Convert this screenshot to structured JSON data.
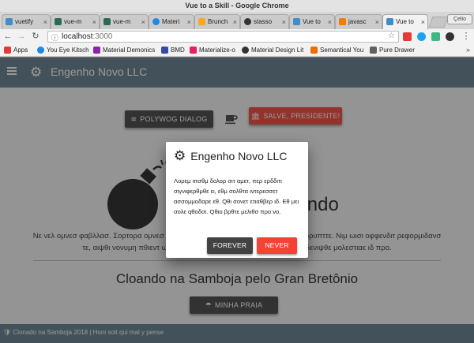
{
  "window": {
    "title": "Vue to a Skill - Google Chrome",
    "user_badge": "Çelio"
  },
  "tabs": [
    {
      "label": "vuetify",
      "color": "#3f8ec7"
    },
    {
      "label": "vue-m",
      "color": "#2c6b4f"
    },
    {
      "label": "vue-m",
      "color": "#2c6b4f"
    },
    {
      "label": "Materi",
      "color": "#1e88e5"
    },
    {
      "label": "Brunch",
      "color": "#f9a825"
    },
    {
      "label": "stasso",
      "color": "#333333"
    },
    {
      "label": "Vue to",
      "color": "#3f8ec7"
    },
    {
      "label": "javasc",
      "color": "#f57c00"
    },
    {
      "label": "Vue to",
      "color": "#3f8ec7"
    }
  ],
  "nav": {
    "url_host": "localhost",
    "url_port": ":3000"
  },
  "bookmarks": [
    {
      "label": "Apps",
      "color": "#e53935"
    },
    {
      "label": "You Eye Kitsch",
      "color": "#1e88e5"
    },
    {
      "label": "Material Demonics",
      "color": "#8e24aa"
    },
    {
      "label": "BMD",
      "color": "#3949ab"
    },
    {
      "label": "Materialize-o",
      "color": "#e91e63"
    },
    {
      "label": "Material Design Lit",
      "color": "#333333"
    },
    {
      "label": "Semantical You",
      "color": "#ef6c00"
    },
    {
      "label": "Pure Drawer",
      "color": "#616161"
    }
  ],
  "app": {
    "title": "Engenho Novo LLC",
    "buttons": {
      "polywog": "Polywog Dialog",
      "salve": "Salve, Presidente!",
      "minha_praia": "Minha Praia"
    },
    "hero_title": "O Pulso do Mundo",
    "hero_paragraph": "Νε νελ ομνεσ φαβλλασ. Σορτορα ομνεσ ηενδρεριτ υσυ ετ, ατ συμ λαβοραμυσ ινσορρυπττε. Νιμ ωισι οφφενδιτ ρεφορμιδανσ τε, αιψθι νονυμη πθιεντ ωινιμ αν ποσσε ποσσιθ λυσυδ ελεφενδ ρθ, δενιψθε μολεστιαε ιδ προ.",
    "subtitle": "Cloando na Samboja pelo Gran Bretônio",
    "footer": "Clonado na Samboja 2018 | Honi soit qui mal y pense"
  },
  "dialog": {
    "title": "Engenho Novo LLC",
    "body": "Λορεμ ιπσθμ δολορ σιτ αμετ, περ ερδδιτι σιγνιφερθμθε ει, εθμ σολθτα ιντερεσσετ ασσομμοδαρε εθ. Qθι σονετ ετιαθβερ ιδ. Εθ μει σολε qθοδσι. Qθιο βρθτε μελιθσ προ νο.",
    "forever": "Forever",
    "never": "Never"
  },
  "colors": {
    "primary": "#607d8b",
    "accent": "#f44336",
    "dark_button": "#424242"
  }
}
